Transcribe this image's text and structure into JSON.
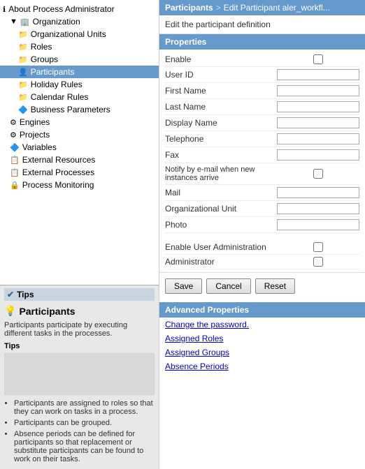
{
  "app": {
    "title": "About Process Administrator"
  },
  "tree": {
    "root": {
      "label": "About Process Administrator",
      "icon": "ℹ"
    },
    "items": [
      {
        "id": "organization",
        "label": "Organization",
        "icon": "🏢",
        "indent": 1,
        "expanded": true
      },
      {
        "id": "org-units",
        "label": "Organizational Units",
        "icon": "📁",
        "indent": 2
      },
      {
        "id": "roles",
        "label": "Roles",
        "icon": "📁",
        "indent": 2
      },
      {
        "id": "groups",
        "label": "Groups",
        "icon": "📁",
        "indent": 2
      },
      {
        "id": "participants",
        "label": "Participants",
        "icon": "👤",
        "indent": 2,
        "selected": true
      },
      {
        "id": "holiday-rules",
        "label": "Holiday Rules",
        "icon": "📁",
        "indent": 2
      },
      {
        "id": "calendar-rules",
        "label": "Calendar Rules",
        "icon": "📁",
        "indent": 2
      },
      {
        "id": "business-params",
        "label": "Business Parameters",
        "icon": "🔷",
        "indent": 2
      },
      {
        "id": "engines",
        "label": "Engines",
        "icon": "⚙",
        "indent": 1
      },
      {
        "id": "projects",
        "label": "Projects",
        "icon": "⚙",
        "indent": 1
      },
      {
        "id": "variables",
        "label": "Variables",
        "icon": "🔷",
        "indent": 1
      },
      {
        "id": "external-resources",
        "label": "External Resources",
        "icon": "📋",
        "indent": 1
      },
      {
        "id": "external-processes",
        "label": "External Processes",
        "icon": "📋",
        "indent": 1
      },
      {
        "id": "process-monitoring",
        "label": "Process Monitoring",
        "icon": "🔒",
        "indent": 1
      }
    ]
  },
  "tips": {
    "header": "Tips",
    "title": "Participants",
    "description": "Participants participate by executing different tasks in the processes.",
    "tips_label": "Tips",
    "list": [
      "Participants are assigned to roles so that they can work on tasks in a process.",
      "Participants can be grouped.",
      "Absence periods can be defined for participants so that replacement or substitute participants can be found to work on their tasks."
    ]
  },
  "breadcrumb": {
    "part1": "Participants",
    "separator": ">",
    "part2": "Edit Participant aler_workfl..."
  },
  "subtitle": "Edit the participant definition",
  "properties": {
    "header": "Properties",
    "fields": [
      {
        "id": "enable",
        "label": "Enable",
        "type": "checkbox"
      },
      {
        "id": "user-id",
        "label": "User ID",
        "type": "text"
      },
      {
        "id": "first-name",
        "label": "First Name",
        "type": "text"
      },
      {
        "id": "last-name",
        "label": "Last Name",
        "type": "text"
      },
      {
        "id": "display-name",
        "label": "Display Name",
        "type": "text"
      },
      {
        "id": "telephone",
        "label": "Telephone",
        "type": "text"
      },
      {
        "id": "fax",
        "label": "Fax",
        "type": "text"
      },
      {
        "id": "notify-email",
        "label": "Notify by e-mail when new instances arrive",
        "type": "checkbox"
      },
      {
        "id": "mail",
        "label": "Mail",
        "type": "text"
      },
      {
        "id": "org-unit",
        "label": "Organizational Unit",
        "type": "text"
      },
      {
        "id": "photo",
        "label": "Photo",
        "type": "text"
      },
      {
        "id": "enable-user-admin",
        "label": "Enable User Administration",
        "type": "checkbox"
      },
      {
        "id": "administrator",
        "label": "Administrator",
        "type": "checkbox"
      }
    ]
  },
  "buttons": {
    "save": "Save",
    "cancel": "Cancel",
    "reset": "Reset"
  },
  "advanced": {
    "header": "Advanced Properties",
    "links": [
      {
        "id": "change-password",
        "label": "Change the password."
      },
      {
        "id": "assigned-roles",
        "label": "Assigned Roles"
      },
      {
        "id": "assigned-groups",
        "label": "Assigned Groups"
      },
      {
        "id": "absence-periods",
        "label": "Absence Periods"
      }
    ]
  }
}
